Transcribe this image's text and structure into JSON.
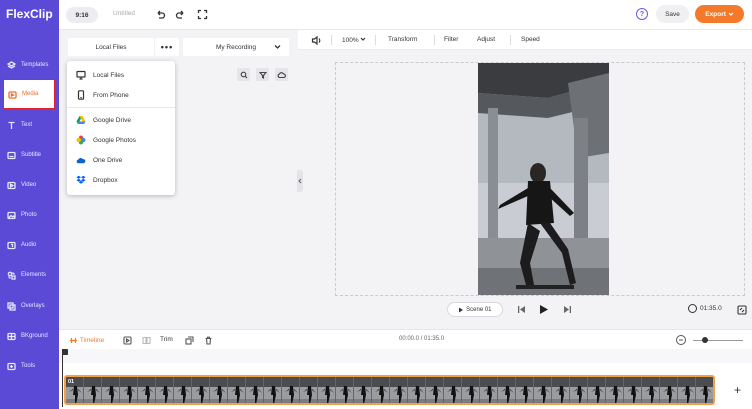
{
  "brand": {
    "logo_text": "FlexClip",
    "accent": "#5a4ad6",
    "orange": "#f5792a"
  },
  "topbar": {
    "ratio": "9:16",
    "title": "Untitled",
    "save_label": "Save",
    "export_label": "Export",
    "help": "?"
  },
  "sidebar": {
    "items": [
      {
        "label": "Templates",
        "icon": "layers-icon"
      },
      {
        "label": "Media",
        "icon": "media-folder-icon",
        "active": true
      },
      {
        "label": "Text",
        "icon": "text-icon"
      },
      {
        "label": "Subtitle",
        "icon": "subtitle-icon"
      },
      {
        "label": "Video",
        "icon": "video-icon"
      },
      {
        "label": "Photo",
        "icon": "photo-icon"
      },
      {
        "label": "Audio",
        "icon": "audio-icon"
      },
      {
        "label": "Elements",
        "icon": "elements-icon"
      },
      {
        "label": "Overlays",
        "icon": "overlays-icon"
      },
      {
        "label": "BKground",
        "icon": "background-icon"
      },
      {
        "label": "Tools",
        "icon": "tools-icon"
      }
    ]
  },
  "media_panel": {
    "tab_local": "Local Files",
    "tab_more": "•••",
    "tab_recording": "My Recording"
  },
  "dropdown": {
    "items": [
      {
        "label": "Local Files",
        "icon": "monitor-icon"
      },
      {
        "label": "From Phone",
        "icon": "phone-icon"
      },
      {
        "label": "Google Drive",
        "icon": "google-drive-icon"
      },
      {
        "label": "Google Photos",
        "icon": "google-photos-icon"
      },
      {
        "label": "One Drive",
        "icon": "onedrive-icon"
      },
      {
        "label": "Dropbox",
        "icon": "dropbox-icon"
      }
    ]
  },
  "preview_toolbar": {
    "zoom": "100%",
    "transform": "Transform",
    "filter": "Filter",
    "adjust": "Adjust",
    "speed": "Speed"
  },
  "playback": {
    "scene": "Scene 01",
    "duration": "01:35.0"
  },
  "timeline": {
    "label": "Timeline",
    "trim": "Trim",
    "timecode": "00:00.0 / 01:35.0",
    "clip_label": "01",
    "add": "+"
  }
}
